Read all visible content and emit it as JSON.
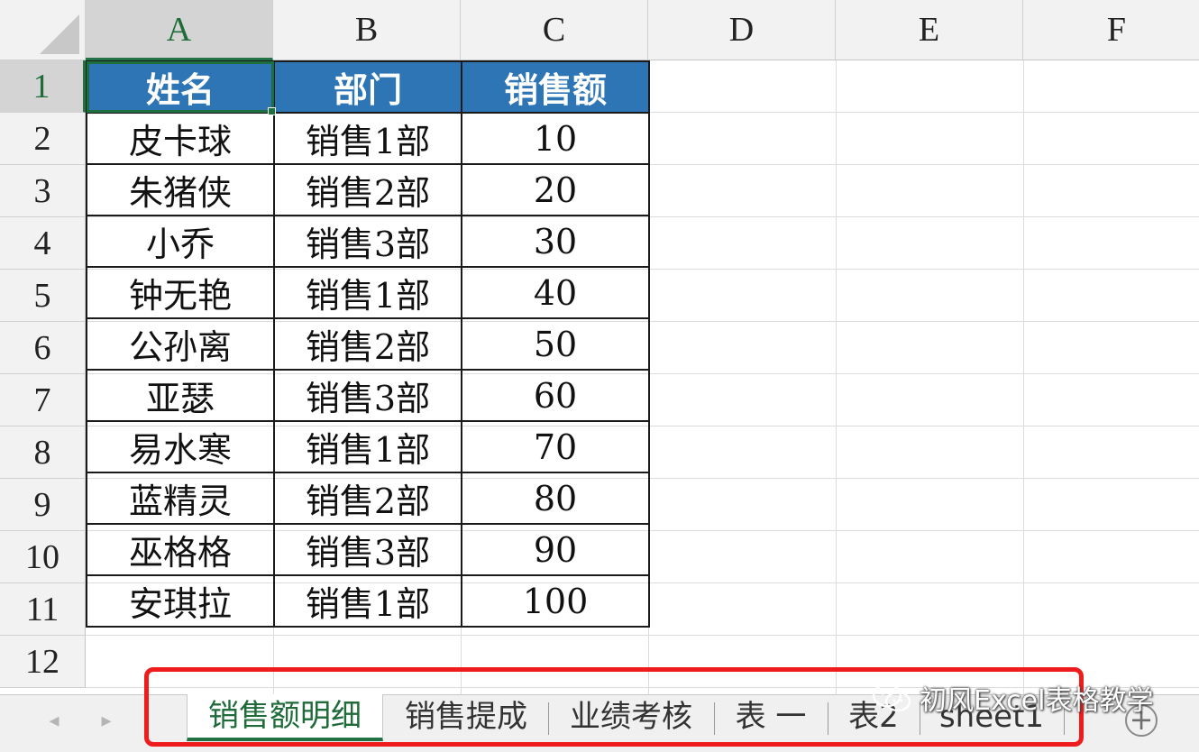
{
  "sheet": {
    "columns": [
      "A",
      "B",
      "C",
      "D",
      "E",
      "F"
    ],
    "rows": [
      "1",
      "2",
      "3",
      "4",
      "5",
      "6",
      "7",
      "8",
      "9",
      "10",
      "11",
      "12"
    ],
    "selected_cell": "A1",
    "header_color": "#2e75b6",
    "selection_color": "#217346",
    "table": {
      "headers": [
        "姓名",
        "部门",
        "销售额"
      ],
      "rows": [
        [
          "皮卡球",
          "销售1部",
          "10"
        ],
        [
          "朱猪侠",
          "销售2部",
          "20"
        ],
        [
          "小乔",
          "销售3部",
          "30"
        ],
        [
          "钟无艳",
          "销售1部",
          "40"
        ],
        [
          "公孙离",
          "销售2部",
          "50"
        ],
        [
          "亚瑟",
          "销售3部",
          "60"
        ],
        [
          "易水寒",
          "销售1部",
          "70"
        ],
        [
          "蓝精灵",
          "销售2部",
          "80"
        ],
        [
          "巫格格",
          "销售3部",
          "90"
        ],
        [
          "安琪拉",
          "销售1部",
          "100"
        ]
      ]
    }
  },
  "tabbar": {
    "prev_icon": "chevron-left-icon",
    "next_icon": "chevron-right-icon",
    "tabs": [
      {
        "label": "销售额明细",
        "active": true
      },
      {
        "label": "销售提成",
        "active": false
      },
      {
        "label": "业绩考核",
        "active": false
      },
      {
        "label": "表 一",
        "active": false
      },
      {
        "label": "表2",
        "active": false
      },
      {
        "label": "sheet1",
        "active": false
      }
    ],
    "add_icon": "plus-circle-icon",
    "highlight_color": "#ee1c1c"
  },
  "watermark": {
    "text": "初风Excel表格教学",
    "icon": "wechat-icon"
  }
}
